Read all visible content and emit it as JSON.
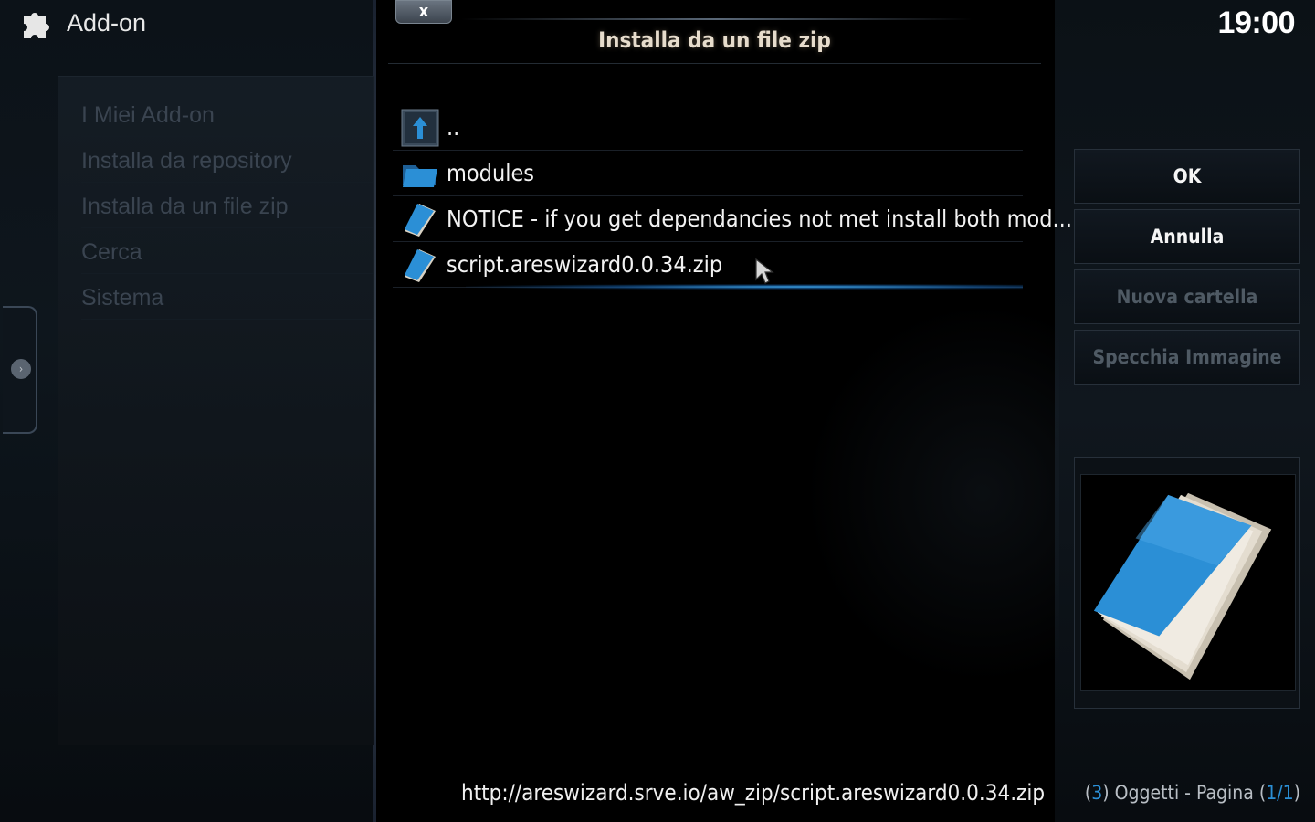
{
  "header": {
    "app_title": "Add-on",
    "icon": "puzzle-icon"
  },
  "clock": "19:00",
  "left_menu": {
    "items": [
      {
        "label": "I Miei Add-on"
      },
      {
        "label": "Installa da repository"
      },
      {
        "label": "Installa da un file zip"
      },
      {
        "label": "Cerca"
      },
      {
        "label": "Sistema"
      }
    ]
  },
  "dialog": {
    "title": "Installa da un file zip",
    "close_label": "x",
    "files": [
      {
        "label": "..",
        "icon": "parent-folder-icon"
      },
      {
        "label": "modules",
        "icon": "folder-icon"
      },
      {
        "label": "NOTICE - if you get dependancies not met install both mod...",
        "icon": "zip-file-icon"
      },
      {
        "label": "script.areswizard0.0.34.zip",
        "icon": "zip-file-icon",
        "selected": true
      }
    ]
  },
  "buttons": {
    "ok": "OK",
    "cancel": "Annulla",
    "new_folder": "Nuova cartella",
    "mirror_image": "Specchia Immagine"
  },
  "footer": {
    "path": "http://areswizard.srve.io/aw_zip/script.areswizard0.0.34.zip",
    "count": "3",
    "items_label": "Oggetti - Pagina",
    "page": "1/1"
  },
  "colors": {
    "accent": "#2b8fd6",
    "disabled_text": "#4f5a64"
  }
}
